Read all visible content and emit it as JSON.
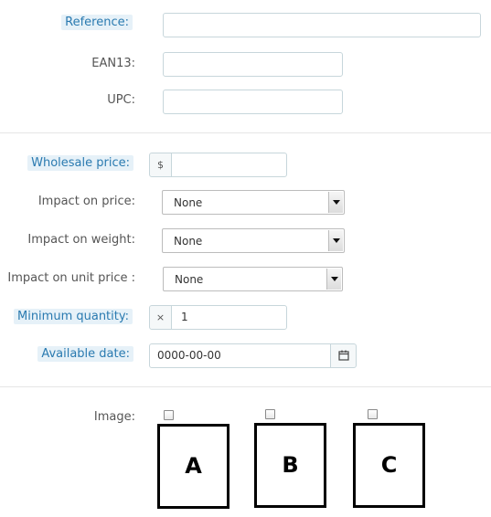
{
  "fields": {
    "reference": {
      "label": "Reference:",
      "value": ""
    },
    "ean13": {
      "label": "EAN13:",
      "value": ""
    },
    "upc": {
      "label": "UPC:",
      "value": ""
    },
    "wholesale_price": {
      "label": "Wholesale price:",
      "prefix": "$",
      "value": ""
    },
    "impact_price": {
      "label": "Impact on price:",
      "selected": "None"
    },
    "impact_weight": {
      "label": "Impact on weight:",
      "selected": "None"
    },
    "impact_unit_price": {
      "label": "Impact on unit price :",
      "selected": "None"
    },
    "minimum_quantity": {
      "label": "Minimum quantity:",
      "prefix": "×",
      "value": "1"
    },
    "available_date": {
      "label": "Available date:",
      "value": "0000-00-00"
    }
  },
  "images": {
    "label": "Image:",
    "items": [
      {
        "letter": "A",
        "checked": false
      },
      {
        "letter": "B",
        "checked": false
      },
      {
        "letter": "C",
        "checked": false
      }
    ]
  },
  "colors": {
    "highlight_bg": "#e6f1f8",
    "highlight_text": "#2a7ab0",
    "border": "#c7d6db"
  }
}
